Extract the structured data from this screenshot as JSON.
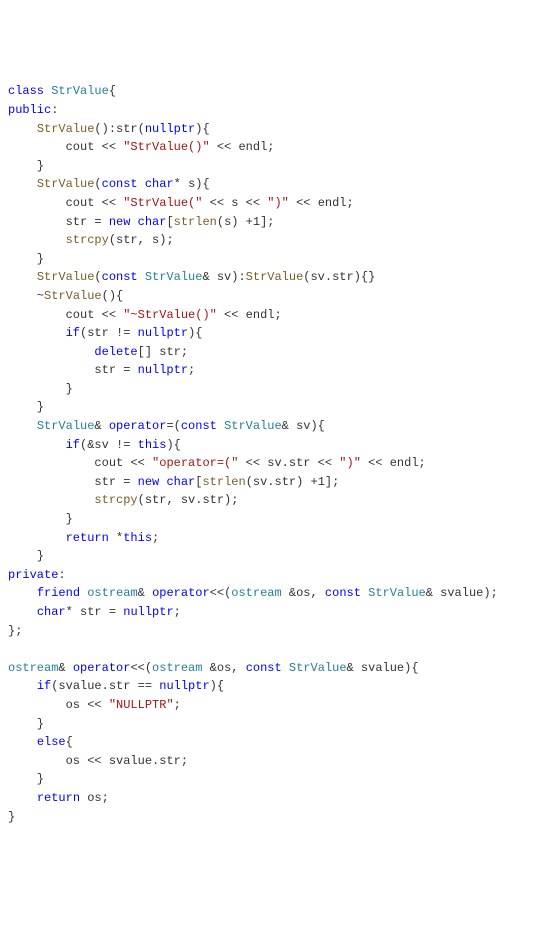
{
  "chart_data": null,
  "code": {
    "class_kw": "class",
    "class_name": "StrValue",
    "public_kw": "public",
    "private_kw": "private",
    "ctor0_name": "StrValue",
    "ctor0_init_field": "str",
    "ctor0_init_val": "nullptr",
    "ctor0_cout": "cout",
    "ctor0_lit": "\"StrValue()\"",
    "ctor0_endl": "endl",
    "ctor1_name": "StrValue",
    "ctor1_param_kw": "const",
    "ctor1_param_type": "char",
    "ctor1_param_name": "s",
    "ctor1_cout": "cout",
    "ctor1_lit1": "\"StrValue(\"",
    "ctor1_lit2": "\")\"",
    "ctor1_endl": "endl",
    "ctor1_str": "str",
    "ctor1_new": "new",
    "ctor1_char": "char",
    "ctor1_strlen": "strlen",
    "ctor1_plus1": "1",
    "ctor1_strcpy": "strcpy",
    "ctor2_name": "StrValue",
    "ctor2_param_kw": "const",
    "ctor2_param_type": "StrValue",
    "ctor2_param_name": "sv",
    "ctor2_deleg": "StrValue",
    "ctor2_arg": "sv.str",
    "dtor_name": "StrValue",
    "dtor_cout": "cout",
    "dtor_lit": "\"~StrValue()\"",
    "dtor_endl": "endl",
    "dtor_if": "if",
    "dtor_str": "str",
    "dtor_null": "nullptr",
    "dtor_delete": "delete",
    "opeq_ret": "StrValue",
    "opeq_kw": "operator",
    "opeq_param_kw": "const",
    "opeq_param_type": "StrValue",
    "opeq_param_name": "sv",
    "opeq_if": "if",
    "opeq_this": "this",
    "opeq_cout": "cout",
    "opeq_lit1": "\"operator=(\"",
    "opeq_lit2": "\")\"",
    "opeq_endl": "endl",
    "opeq_str": "str",
    "opeq_new": "new",
    "opeq_char": "char",
    "opeq_strlen": "strlen",
    "opeq_plus1": "1",
    "opeq_strcpy": "strcpy",
    "opeq_return": "return",
    "friend_kw": "friend",
    "friend_ret": "ostream",
    "friend_op": "operator",
    "friend_p1_type": "ostream",
    "friend_p1_name": "os",
    "friend_p2_kw": "const",
    "friend_p2_type": "StrValue",
    "friend_p2_name": "svalue",
    "member_type": "char",
    "member_name": "str",
    "member_init": "nullptr",
    "free_ret": "ostream",
    "free_op": "operator",
    "free_p1_type": "ostream",
    "free_p1_name": "os",
    "free_p2_kw": "const",
    "free_p2_type": "StrValue",
    "free_p2_name": "svalue",
    "free_if": "if",
    "free_null": "nullptr",
    "free_lit": "\"NULLPTR\"",
    "free_else": "else",
    "free_return": "return"
  }
}
